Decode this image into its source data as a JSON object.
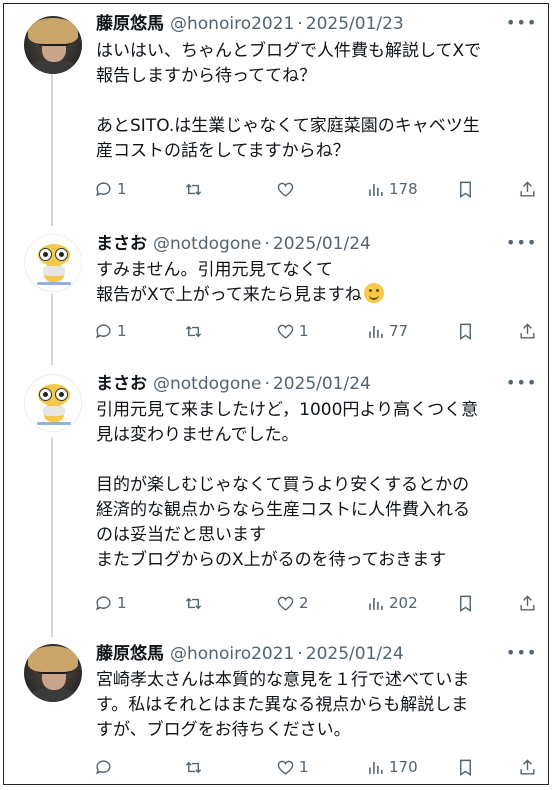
{
  "tweets": [
    {
      "name": "藤原悠馬",
      "handle": "@honoiro2021",
      "date": "2025/01/23",
      "avatar": "person-with-straw-hat",
      "lines": [
        "はいはい、ちゃんとブログで人件費も解説してXで",
        "報告しますから待っててね？",
        "",
        "あとSITO.は生業じゃなくて家庭菜園のキャベツ生",
        "産コストの話をしてますからね？"
      ],
      "replies": "1",
      "retweets": "",
      "likes": "",
      "views": "178"
    },
    {
      "name": "まさお",
      "handle": "@notdogone",
      "date": "2025/01/24",
      "avatar": "yellow-frog-character",
      "lines": [
        "すみません。引用元見てなくて",
        "報告がXで上がって来たら見ますね"
      ],
      "replies": "1",
      "retweets": "",
      "likes": "1",
      "views": "77"
    },
    {
      "name": "まさお",
      "handle": "@notdogone",
      "date": "2025/01/24",
      "avatar": "yellow-frog-character",
      "lines": [
        "引用元見て来ましたけど，1000円より高くつく意",
        "見は変わりませんでした。",
        "",
        "目的が楽しむじゃなくて買うより安くするとかの",
        "経済的な観点からなら生産コストに人件費入れる",
        "のは妥当だと思います",
        "またブログからのX上がるのを待っておきます"
      ],
      "replies": "1",
      "retweets": "",
      "likes": "2",
      "views": "202"
    },
    {
      "name": "藤原悠馬",
      "handle": "@honoiro2021",
      "date": "2025/01/24",
      "avatar": "person-with-straw-hat",
      "lines": [
        "宮崎孝太さんは本質的な意見を１行で述べていま",
        "す。私はそれとはまた異なる視点からも解説しま",
        "すが、ブログをお待ちください。"
      ],
      "replies": "",
      "retweets": "",
      "likes": "1",
      "views": "170"
    }
  ],
  "separator": "·",
  "more_glyph": "•••",
  "icons": {
    "reply": "reply-icon",
    "retweet": "retweet-icon",
    "like": "like-icon",
    "views": "views-icon",
    "bookmark": "bookmark-icon",
    "share": "share-icon",
    "emoji": "smiling-face-emoji"
  },
  "colors": {
    "text": "#0f1419",
    "muted": "#536471",
    "thread_line": "#cfd9de"
  }
}
